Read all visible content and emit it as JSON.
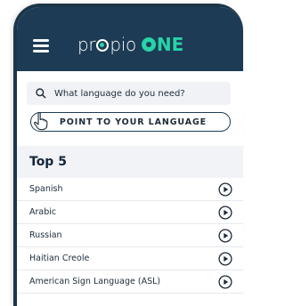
{
  "brand": {
    "wordmark": "pr",
    "wordmark_tail": "pio",
    "one_tail": "NE",
    "accent_color": "#27d3a8",
    "header_color": "#1d3b55"
  },
  "search": {
    "placeholder": "What language do you need?"
  },
  "point_button": {
    "label": "POINT TO YOUR LANGUAGE"
  },
  "top_section": {
    "title": "Top 5",
    "languages": [
      {
        "name": "Spanish"
      },
      {
        "name": "Arabic"
      },
      {
        "name": "Russian"
      },
      {
        "name": "Haitian Creole"
      },
      {
        "name": "American Sign Language (ASL)"
      }
    ]
  },
  "icons": [
    "menu-icon",
    "search-icon",
    "pointing-hand-icon",
    "play-icon"
  ]
}
